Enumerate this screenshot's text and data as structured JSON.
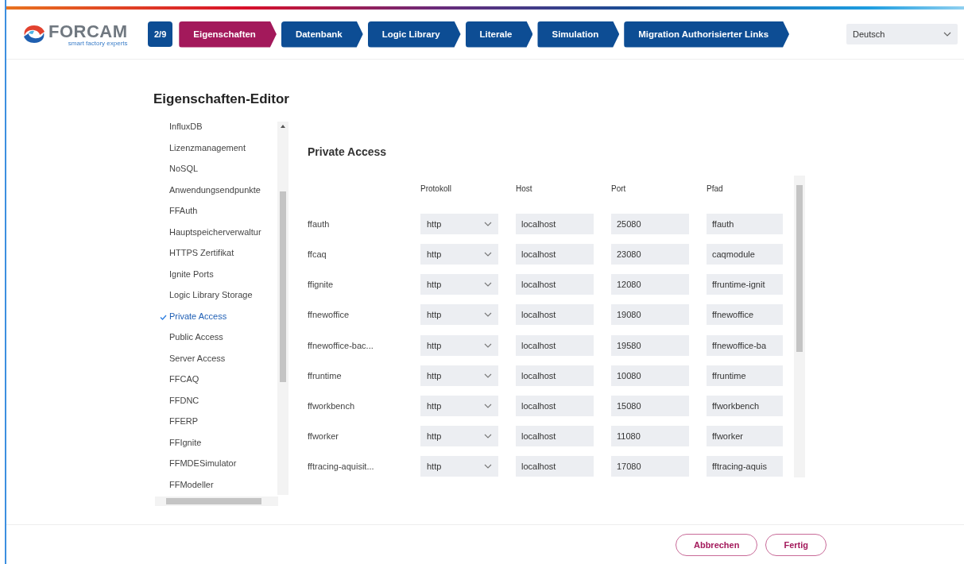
{
  "header": {
    "logo": {
      "name": "FORCAM",
      "tagline": "smart factory experts"
    },
    "step_counter": "2/9",
    "steps": [
      {
        "label": "Eigenschaften",
        "selected": true
      },
      {
        "label": "Datenbank",
        "selected": false
      },
      {
        "label": "Logic Library",
        "selected": false
      },
      {
        "label": "Literale",
        "selected": false
      },
      {
        "label": "Simulation",
        "selected": false
      },
      {
        "label": "Migration Authorisierter Links",
        "selected": false
      }
    ],
    "language": {
      "value": "Deutsch"
    }
  },
  "page_title": "Eigenschaften-Editor",
  "sidebar": {
    "items": [
      {
        "label": "InfluxDB",
        "selected": false
      },
      {
        "label": "Lizenzmanagement",
        "selected": false
      },
      {
        "label": "NoSQL",
        "selected": false
      },
      {
        "label": "Anwendungsendpunkte",
        "selected": false
      },
      {
        "label": "FFAuth",
        "selected": false
      },
      {
        "label": "Hauptspeicherverwaltur",
        "selected": false
      },
      {
        "label": "HTTPS Zertifikat",
        "selected": false
      },
      {
        "label": "Ignite Ports",
        "selected": false
      },
      {
        "label": "Logic Library Storage",
        "selected": false
      },
      {
        "label": "Private Access",
        "selected": true
      },
      {
        "label": "Public Access",
        "selected": false
      },
      {
        "label": "Server Access",
        "selected": false
      },
      {
        "label": "FFCAQ",
        "selected": false
      },
      {
        "label": "FFDNC",
        "selected": false
      },
      {
        "label": "FFERP",
        "selected": false
      },
      {
        "label": "FFIgnite",
        "selected": false
      },
      {
        "label": "FFMDESimulator",
        "selected": false
      },
      {
        "label": "FFModeller",
        "selected": false
      }
    ]
  },
  "section": {
    "title": "Private Access",
    "table": {
      "columns": [
        "Protokoll",
        "Host",
        "Port",
        "Pfad"
      ],
      "rows": [
        {
          "name": "ffauth",
          "protocol": "http",
          "host": "localhost",
          "port": "25080",
          "path": "ffauth"
        },
        {
          "name": "ffcaq",
          "protocol": "http",
          "host": "localhost",
          "port": "23080",
          "path": "caqmodule"
        },
        {
          "name": "ffignite",
          "protocol": "http",
          "host": "localhost",
          "port": "12080",
          "path": "ffruntime-ignit"
        },
        {
          "name": "ffnewoffice",
          "protocol": "http",
          "host": "localhost",
          "port": "19080",
          "path": "ffnewoffice"
        },
        {
          "name": "ffnewoffice-bac...",
          "protocol": "http",
          "host": "localhost",
          "port": "19580",
          "path": "ffnewoffice-ba"
        },
        {
          "name": "ffruntime",
          "protocol": "http",
          "host": "localhost",
          "port": "10080",
          "path": "ffruntime"
        },
        {
          "name": "ffworkbench",
          "protocol": "http",
          "host": "localhost",
          "port": "15080",
          "path": "ffworkbench"
        },
        {
          "name": "ffworker",
          "protocol": "http",
          "host": "localhost",
          "port": "11080",
          "path": "ffworker"
        },
        {
          "name": "fftracing-aquisit...",
          "protocol": "http",
          "host": "localhost",
          "port": "17080",
          "path": "fftracing-aquis"
        }
      ]
    }
  },
  "footer": {
    "buttons": [
      "Abbrechen",
      "Fertig"
    ]
  }
}
